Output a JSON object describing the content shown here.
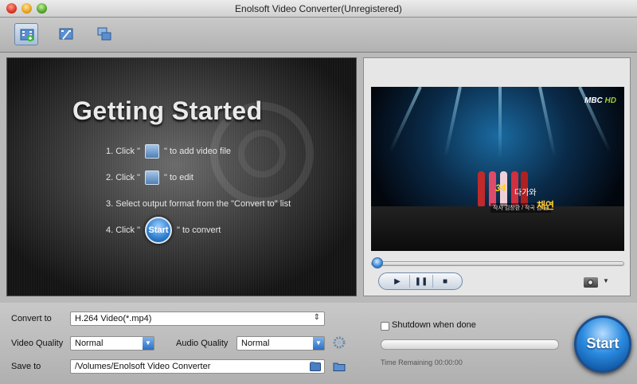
{
  "window": {
    "title": "Enolsoft Video Converter(Unregistered)"
  },
  "toolbar": {
    "items": [
      {
        "icon": "add-video-icon"
      },
      {
        "icon": "edit-video-icon"
      },
      {
        "icon": "merge-video-icon"
      }
    ]
  },
  "getting_started": {
    "heading": "Getting Started",
    "steps": [
      {
        "prefix": "1. Click \"",
        "suffix": "\" to add video file",
        "icon": "add-video-icon"
      },
      {
        "prefix": "2. Click \"",
        "suffix": "\" to edit",
        "icon": "edit-video-icon"
      },
      {
        "text": "3. Select output format from the \"Convert to\" list"
      },
      {
        "prefix": "4. Click \"",
        "suffix": "\" to convert",
        "button": "Start"
      }
    ]
  },
  "preview": {
    "logo_brand": "MBC",
    "logo_sub": "HD",
    "caption_number": "34",
    "caption_title": "다가와",
    "caption_artist": "채연",
    "caption_sub": "작사 김창환 / 작곡 김 홍",
    "seek_position": 0.03,
    "controls": {
      "play": "▶",
      "pause": "❚❚",
      "stop": "■"
    },
    "snapshot_icon": "camera-icon"
  },
  "settings": {
    "convert_to_label": "Convert to",
    "convert_to_value": "H.264 Video(*.mp4)",
    "video_quality_label": "Video Quality",
    "video_quality_value": "Normal",
    "audio_quality_label": "Audio Quality",
    "audio_quality_value": "Normal",
    "save_to_label": "Save to",
    "save_to_value": "/Volumes/Enolsoft Video Converter",
    "shutdown_label": "Shutdown when done",
    "shutdown_checked": false,
    "progress": 0,
    "time_remaining": "Time Remaining 00:00:00",
    "start_label": "Start"
  },
  "colors": {
    "accent": "#2a8be0",
    "panel_dark": "#141414",
    "window_bg": "#b9b9b9"
  }
}
